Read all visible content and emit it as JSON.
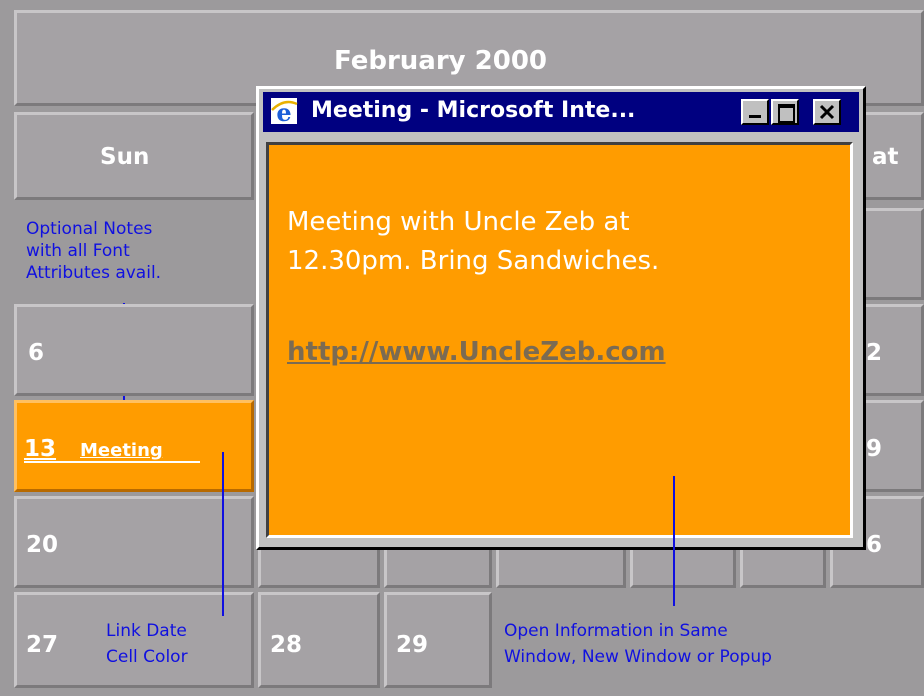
{
  "calendar": {
    "month_title": "February 2000",
    "day_headers": {
      "sun": "Sun",
      "sat": "at"
    },
    "cells": {
      "d6": "6",
      "d13": "13",
      "d13_event": "Meeting",
      "d20": "20",
      "d27": "27",
      "d28": "28",
      "d29": "29",
      "sat_a": "2",
      "sat_b": "9",
      "sat_c": "6"
    },
    "highlight_color": "#ff9c00"
  },
  "annotations": {
    "notes": [
      "Optional Notes",
      "with all Font",
      "Attributes avail."
    ],
    "link_color": [
      "Link Date",
      "Cell Color"
    ],
    "open_info": [
      "Open Information in Same",
      "Window, New Window or Popup"
    ]
  },
  "popup": {
    "title": "Meeting - Microsoft Inte...",
    "icon": "internet-explorer-icon",
    "message_lines": [
      "Meeting with Uncle Zeb at",
      "12.30pm. Bring Sandwiches."
    ],
    "link": "http://www.UncleZeb.com",
    "buttons": {
      "minimize": "minimize-icon",
      "maximize": "maximize-icon",
      "close": "close-icon"
    }
  }
}
